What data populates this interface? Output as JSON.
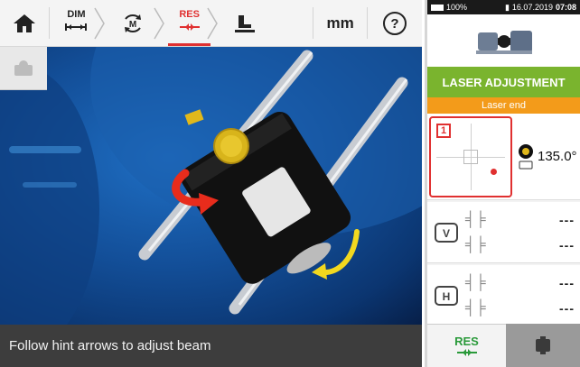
{
  "toolbar": {
    "dim_label": "DIM",
    "res_label": "RES",
    "unit_label": "mm"
  },
  "hint": {
    "text": "Follow hint arrows to adjust beam"
  },
  "status": {
    "battery": "100%",
    "datetime": "16.07.2019",
    "time": "07:08"
  },
  "panel": {
    "laser_adjustment_label": "LASER ADJUSTMENT",
    "laser_end_label": "Laser end",
    "target_number": "1",
    "angle_value": "135.0°",
    "vertical": {
      "offset": "---",
      "angle": "---"
    },
    "horizontal": {
      "offset": "---",
      "angle": "---"
    },
    "res_button_label": "RES"
  },
  "colors": {
    "accent_red": "#e03030",
    "green": "#7ab42e",
    "orange": "#f39b1a"
  }
}
